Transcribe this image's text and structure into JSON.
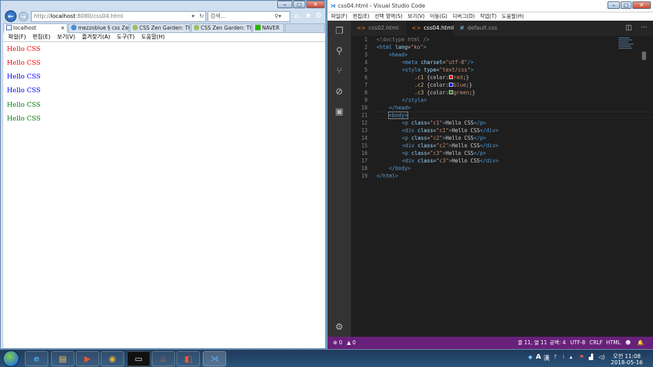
{
  "ie": {
    "url_prefix": "http://",
    "url_host": "localhost",
    "url_rest": ":8080/css04.html",
    "search_placeholder": "검색...",
    "tabs": [
      {
        "label": "localhost",
        "close": "×",
        "active": true
      },
      {
        "label": "mezzoblue § css Zen...",
        "active": false
      },
      {
        "label": "CSS Zen Garden: The...",
        "active": false
      },
      {
        "label": "CSS Zen Garden: The...",
        "active": false
      },
      {
        "label": "NAVER",
        "active": false
      }
    ],
    "menu": [
      "파일(F)",
      "편집(E)",
      "보기(V)",
      "즐겨찾기(A)",
      "도구(T)",
      "도움말(H)"
    ],
    "content": [
      {
        "text": "Hello CSS",
        "color": "#ff0000"
      },
      {
        "text": "Hello CSS",
        "color": "#ff0000"
      },
      {
        "text": "Hello CSS",
        "color": "#0000ff"
      },
      {
        "text": "Hello CSS",
        "color": "#0000ff"
      },
      {
        "text": "Hello CSS",
        "color": "#008000"
      },
      {
        "text": "Hello CSS",
        "color": "#008000"
      }
    ]
  },
  "vscode": {
    "title": "css04.html - Visual Studio Code",
    "menu": [
      "파일(F)",
      "편집(E)",
      "선택 영역(S)",
      "보기(V)",
      "이동(G)",
      "디버그(D)",
      "작업(T)",
      "도움말(H)"
    ],
    "tabs": [
      {
        "label": "css02.html",
        "icon": "<>"
      },
      {
        "label": "css04.html",
        "icon": "<>",
        "close": "×",
        "active": true
      },
      {
        "label": "default.css",
        "icon": "#"
      }
    ],
    "line_numbers": [
      "1",
      "2",
      "3",
      "4",
      "5",
      "6",
      "7",
      "8",
      "9",
      "10",
      "11",
      "12",
      "13",
      "14",
      "15",
      "16",
      "17",
      "18",
      "19"
    ],
    "code": {
      "l1": "<!doctype html />",
      "l2_tag": "<html ",
      "l2_attr": "lang",
      "l2_eq": "=",
      "l2_val": "\"ko\"",
      "l2_end": ">",
      "l3": "<head>",
      "l4_tag": "<meta ",
      "l4_attr": "charset",
      "l4_eq": "=",
      "l4_val": "\"utf-8\"",
      "l4_end": "/>",
      "l5_tag": "<style ",
      "l5_attr": "type",
      "l5_eq": "=",
      "l5_val": "\"text/css\"",
      "l5_end": ">",
      "l6_sel": ".c1",
      "l6_a": " {color:",
      "l6_v": "red",
      "l6_b": ";}",
      "l7_sel": ".c2",
      "l7_a": " {color:",
      "l7_v": "blue",
      "l7_b": ";}",
      "l8_sel": ".c3",
      "l8_a": " {color:",
      "l8_v": "green",
      "l8_b": ";}",
      "l9": "</style>",
      "l10": "</head>",
      "l11": "<body>",
      "l12_a": "<p ",
      "l12_b": "class",
      "l12_c": "=",
      "l12_d": "\"c1\"",
      "l12_e": ">",
      "l12_f": "Hello CSS",
      "l12_g": "</p>",
      "l13_a": "<div ",
      "l13_b": "class",
      "l13_c": "=",
      "l13_d": "\"c1\"",
      "l13_e": ">",
      "l13_f": "Hello CSS",
      "l13_g": "</div>",
      "l14_a": "<p ",
      "l14_b": "class",
      "l14_c": "=",
      "l14_d": "\"c2\"",
      "l14_e": ">",
      "l14_f": "Hello CSS",
      "l14_g": "</p>",
      "l15_a": "<div ",
      "l15_b": "class",
      "l15_c": "=",
      "l15_d": "\"c2\"",
      "l15_e": ">",
      "l15_f": "Hello CSS",
      "l15_g": "</div>",
      "l16_a": "<p ",
      "l16_b": "class",
      "l16_c": "=",
      "l16_d": "\"c3\"",
      "l16_e": ">",
      "l16_f": "Hello CSS",
      "l16_g": "</p>",
      "l17_a": "<div ",
      "l17_b": "class",
      "l17_c": "=",
      "l17_d": "\"c3\"",
      "l17_e": ">",
      "l17_f": "Hello CSS",
      "l17_g": "</div>",
      "l18": "</body>",
      "l19": "</html>"
    },
    "swatches": {
      "red": "#ff0000",
      "blue": "#0000ff",
      "green": "#008000"
    },
    "status": {
      "errors": "⊗ 0",
      "warnings": "▲ 0",
      "position": "줄 11, 열 11",
      "spaces": "공백: 4",
      "encoding": "UTF-8",
      "eol": "CRLF",
      "language": "HTML",
      "smiley": "☻",
      "bell": "🔔"
    }
  },
  "taskbar": {
    "clock_time": "오전 11:08",
    "clock_date": "2018-05-16",
    "ime_a": "A",
    "ime_han": "漢"
  },
  "colors": {
    "vscode_status": "#68217a",
    "vscode_activity": "#333333",
    "vscode_editor": "#1e1e1e"
  }
}
